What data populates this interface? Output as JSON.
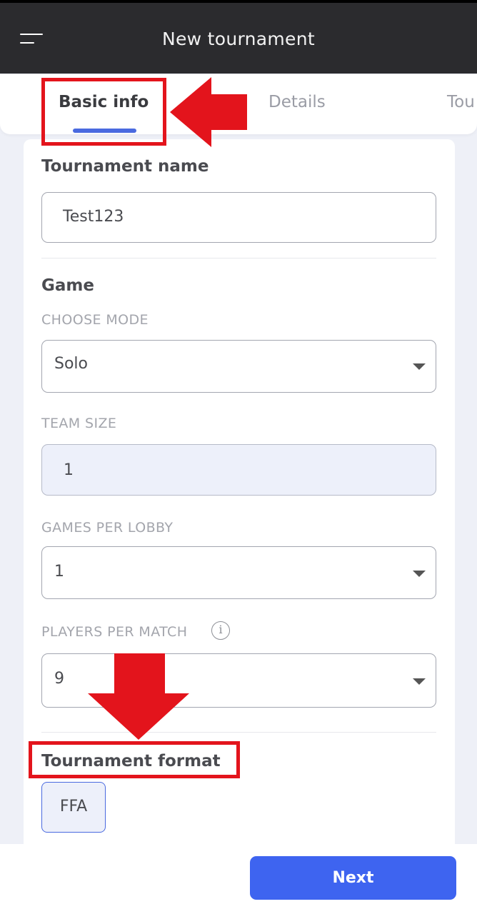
{
  "header": {
    "title": "New tournament"
  },
  "tabs": [
    {
      "label": "Basic info",
      "active": true
    },
    {
      "label": "Details",
      "active": false
    },
    {
      "label": "Tou",
      "active": false
    }
  ],
  "form": {
    "tournament_name": {
      "label": "Tournament name",
      "value": "Test123"
    },
    "game": {
      "heading": "Game",
      "mode": {
        "label": "CHOOSE MODE",
        "value": "Solo"
      },
      "team_size": {
        "label": "TEAM SIZE",
        "value": "1"
      },
      "games_per_lobby": {
        "label": "GAMES PER LOBBY",
        "value": "1"
      },
      "players_per_match": {
        "label": "PLAYERS PER MATCH",
        "value": "9",
        "info_glyph": "i"
      }
    },
    "format": {
      "label": "Tournament format",
      "selected": "FFA"
    }
  },
  "footer": {
    "next_label": "Next"
  },
  "icons": {
    "menu": "menu-icon",
    "caret": "caret-down-icon",
    "info": "info-icon",
    "annotation_arrow": "red-arrow-icon"
  },
  "colors": {
    "accent": "#3e64f0",
    "tab_indicator": "#4a6ae0",
    "annotation": "#e3141c",
    "header_bg": "#2b2b2e"
  }
}
